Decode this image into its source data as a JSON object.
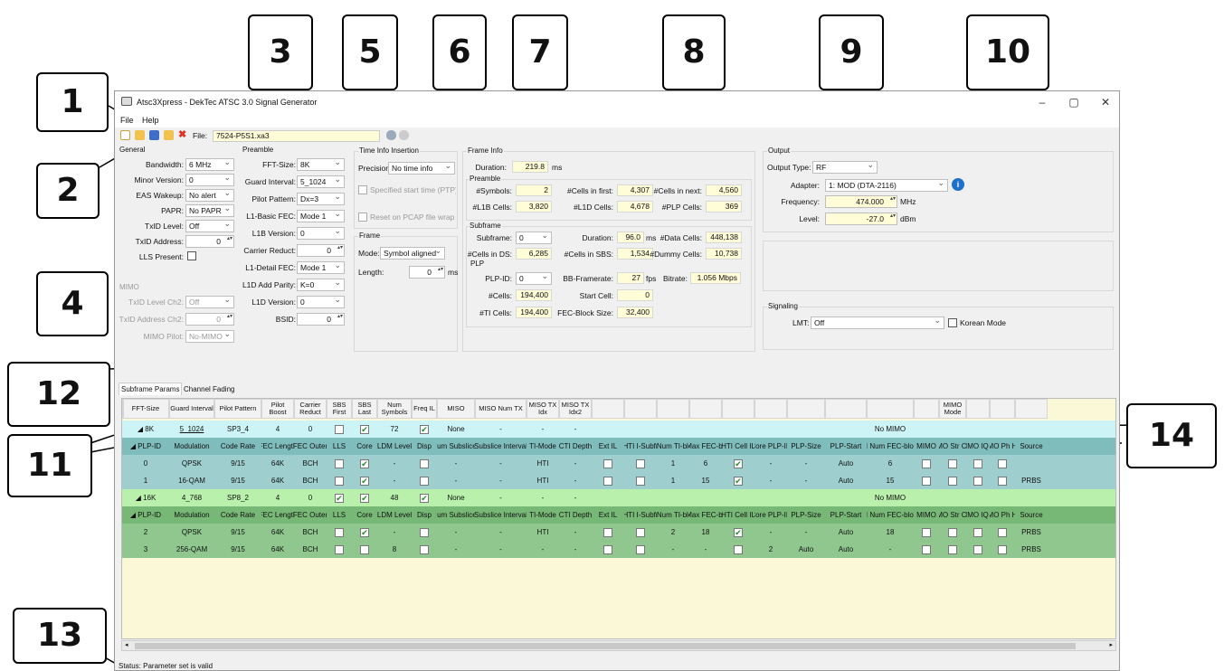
{
  "window": {
    "title": "Atsc3Xpress - DekTec ATSC 3.0 Signal Generator",
    "min": "–",
    "max": "▢",
    "close": "✕"
  },
  "menu": {
    "file": "File",
    "help": "Help"
  },
  "toolbar": {
    "file_label": "File:",
    "file_value": "7524-P5S1.xa3"
  },
  "general": {
    "title": "General",
    "bandwidth_label": "Bandwidth:",
    "bandwidth": "6 MHz",
    "minor_label": "Minor Version:",
    "minor": "0",
    "eas_label": "EAS Wakeup:",
    "eas": "No alert",
    "papr_label": "PAPR:",
    "papr": "No PAPR",
    "txid_label": "TxID Level:",
    "txid": "Off",
    "txaddr_label": "TxID Address:",
    "txaddr": "0",
    "lls_label": "LLS Present:"
  },
  "mimo": {
    "title": "MIMO",
    "txid_ch2_label": "TxID Level Ch2:",
    "txid_ch2": "Off",
    "txaddr_ch2_label": "TxID Address Ch2:",
    "txaddr_ch2": "0",
    "pilot_label": "MIMO Pilot:",
    "pilot": "No-MIMO"
  },
  "preamble": {
    "title": "Preamble",
    "fft_label": "FFT-Size:",
    "fft": "8K",
    "gi_label": "Guard Interval:",
    "gi": "5_1024",
    "pp_label": "Pilot Pattern:",
    "pp": "Dx=3",
    "l1bfec_label": "L1-Basic FEC:",
    "l1bfec": "Mode 1",
    "l1bver_label": "L1B Version:",
    "l1bver": "0",
    "carrier_label": "Carrier Reduct:",
    "carrier": "0",
    "l1dfec_label": "L1-Detail FEC:",
    "l1dfec": "Mode 1",
    "l1dpar_label": "L1D Add Parity:",
    "l1dpar": "K=0",
    "l1dver_label": "L1D Version:",
    "l1dver": "0",
    "bsid_label": "BSID:",
    "bsid": "0"
  },
  "timeinfo": {
    "title": "Time Info Insertion",
    "precision_label": "Precision:",
    "precision": "No time info",
    "specified": "Specified start time (PTP)",
    "reset": "Reset on PCAP file wrap"
  },
  "frame": {
    "title": "Frame",
    "mode_label": "Mode:",
    "mode": "Symbol aligned",
    "length_label": "Length:",
    "length": "0",
    "length_unit": "ms"
  },
  "frameinfo": {
    "title": "Frame Info",
    "duration_label": "Duration:",
    "duration": "219.8",
    "duration_unit": "ms",
    "preamble_title": "Preamble",
    "nsym_label": "#Symbols:",
    "nsym": "2",
    "cfirst_label": "#Cells in first:",
    "cfirst": "4,307",
    "cnext_label": "#Cells in next:",
    "cnext": "4,560",
    "l1b_label": "#L1B Cells:",
    "l1b": "3,820",
    "l1d_label": "#L1D Cells:",
    "l1d": "4,678",
    "plpc_label": "#PLP Cells:",
    "plpc": "369",
    "subframe_title": "Subframe",
    "sf_label": "Subframe:",
    "sf": "0",
    "sfdur_label": "Duration:",
    "sfdur": "96.0",
    "sfdur_unit": "ms",
    "data_label": "#Data Cells:",
    "data": "448,138",
    "ds_label": "#Cells in DS:",
    "ds": "6,285",
    "sbs_label": "#Cells in SBS:",
    "sbs": "1,534",
    "dummy_label": "#Dummy Cells:",
    "dummy": "10,738",
    "plp_title": "PLP",
    "plpid_label": "PLP-ID:",
    "plpid": "0",
    "bbf_label": "BB-Framerate:",
    "bbf": "27",
    "bbf_unit": "fps",
    "bitrate_label": "Bitrate:",
    "bitrate": "1.056 Mbps",
    "cells_label": "#Cells:",
    "cells": "194,400",
    "startcell_label": "Start Cell:",
    "startcell": "0",
    "ti_label": "#TI Cells:",
    "ti": "194,400",
    "fecbs_label": "FEC-Block Size:",
    "fecbs": "32,400"
  },
  "output": {
    "title": "Output",
    "type_label": "Output Type:",
    "type": "RF",
    "adapter_label": "Adapter:",
    "adapter": "1: MOD (DTA-2116)",
    "freq_label": "Frequency:",
    "freq": "474.000",
    "freq_unit": "MHz",
    "level_label": "Level:",
    "level": "-27.0",
    "level_unit": "dBm"
  },
  "signaling": {
    "title": "Signaling",
    "lmt_label": "LMT:",
    "lmt": "Off",
    "korean": "Korean Mode"
  },
  "tabs": {
    "subframe": "Subframe Params",
    "channel": "Channel Fading"
  },
  "sf_headers": [
    "FFT-Size",
    "Guard Interval",
    "Pilot Pattern",
    "Pilot Boost",
    "Carrier Reduct",
    "SBS First",
    "SBS Last",
    "Num Symbols",
    "Freq IL",
    "MISO",
    "MISO Num TX",
    "MISO TX Idx",
    "MISO TX Idx2",
    "",
    "",
    "",
    "",
    "",
    "",
    "",
    "",
    "",
    "",
    "MIMO Mode",
    "",
    "",
    "",
    "",
    ""
  ],
  "plp_headers": [
    "PLP-ID",
    "Modulation",
    "Code Rate",
    "FEC Length",
    "FEC Outer",
    "LLS",
    "Core",
    "LDM Level",
    "Disp",
    "Num Subslices",
    "Subslice Interval",
    "TI-Mode",
    "CTI Depth",
    "Ext IL",
    "HTI I-Subfr",
    "HTI Num TI-blocks",
    "HTI Max FEC-blocks",
    "HTI Cell IL",
    "Core PLP-ID",
    "PLP-Size",
    "PLP-Start",
    "HTI Num FEC-blocks",
    "MIMO",
    "MIMO Str Cmb",
    "MIMO IQ IL",
    "MIMO Ph Hop",
    "Source"
  ],
  "subframes": [
    {
      "fft": "8K",
      "gi": "5_1024",
      "pp": "SP3_4",
      "boost": "4",
      "cred": "0",
      "first": false,
      "last": true,
      "nsym": "72",
      "fil": true,
      "miso": "None",
      "mnum": "-",
      "midx": "-",
      "midx2": "-",
      "mimo": "No MIMO",
      "plps": [
        {
          "id": "0",
          "mod": "QPSK",
          "cr": "9/15",
          "fl": "64K",
          "fo": "BCH",
          "lls": false,
          "core": true,
          "ldm": "-",
          "disp": false,
          "nss": "-",
          "ssi": "-",
          "ti": "HTI",
          "cti": "-",
          "ext": false,
          "isub": false,
          "nti": "1",
          "maxfec": "6",
          "cil": true,
          "cpid": "-",
          "size": "-",
          "start": "Auto",
          "nfec": "6",
          "src": ""
        },
        {
          "id": "1",
          "mod": "16-QAM",
          "cr": "9/15",
          "fl": "64K",
          "fo": "BCH",
          "lls": false,
          "core": true,
          "ldm": "-",
          "disp": false,
          "nss": "-",
          "ssi": "-",
          "ti": "HTI",
          "cti": "-",
          "ext": false,
          "isub": false,
          "nti": "1",
          "maxfec": "15",
          "cil": true,
          "cpid": "-",
          "size": "-",
          "start": "Auto",
          "nfec": "15",
          "src": "PRBS"
        }
      ]
    },
    {
      "fft": "16K",
      "gi": "4_768",
      "pp": "SP8_2",
      "boost": "4",
      "cred": "0",
      "first": true,
      "last": true,
      "nsym": "48",
      "fil": true,
      "miso": "None",
      "mnum": "-",
      "midx": "-",
      "midx2": "-",
      "mimo": "No MIMO",
      "plps": [
        {
          "id": "2",
          "mod": "QPSK",
          "cr": "9/15",
          "fl": "64K",
          "fo": "BCH",
          "lls": false,
          "core": true,
          "ldm": "-",
          "disp": false,
          "nss": "-",
          "ssi": "-",
          "ti": "HTI",
          "cti": "-",
          "ext": false,
          "isub": false,
          "nti": "2",
          "maxfec": "18",
          "cil": true,
          "cpid": "-",
          "size": "-",
          "start": "Auto",
          "nfec": "18",
          "src": "PRBS"
        },
        {
          "id": "3",
          "mod": "256-QAM",
          "cr": "9/15",
          "fl": "64K",
          "fo": "BCH",
          "lls": false,
          "core": false,
          "ldm": "8",
          "disp": false,
          "nss": "-",
          "ssi": "-",
          "ti": "-",
          "cti": "-",
          "ext": false,
          "isub": false,
          "nti": "-",
          "maxfec": "-",
          "cil": false,
          "cpid": "2",
          "size": "Auto",
          "start": "Auto",
          "nfec": "-",
          "src": "PRBS"
        }
      ]
    }
  ],
  "status": "Status: Parameter set is valid",
  "callouts": [
    "1",
    "2",
    "3",
    "4",
    "5",
    "6",
    "7",
    "8",
    "9",
    "10",
    "11",
    "12",
    "13",
    "14"
  ],
  "colors": {
    "sf1": "#ccf3f5",
    "plp1h": "#7fbdbd",
    "plp1": "#9ecece",
    "sf2": "#b9f0ab",
    "plp2h": "#77b877",
    "plp2": "#8fc78f",
    "yellow": "#fffcd8",
    "info": "#1e70c8"
  }
}
